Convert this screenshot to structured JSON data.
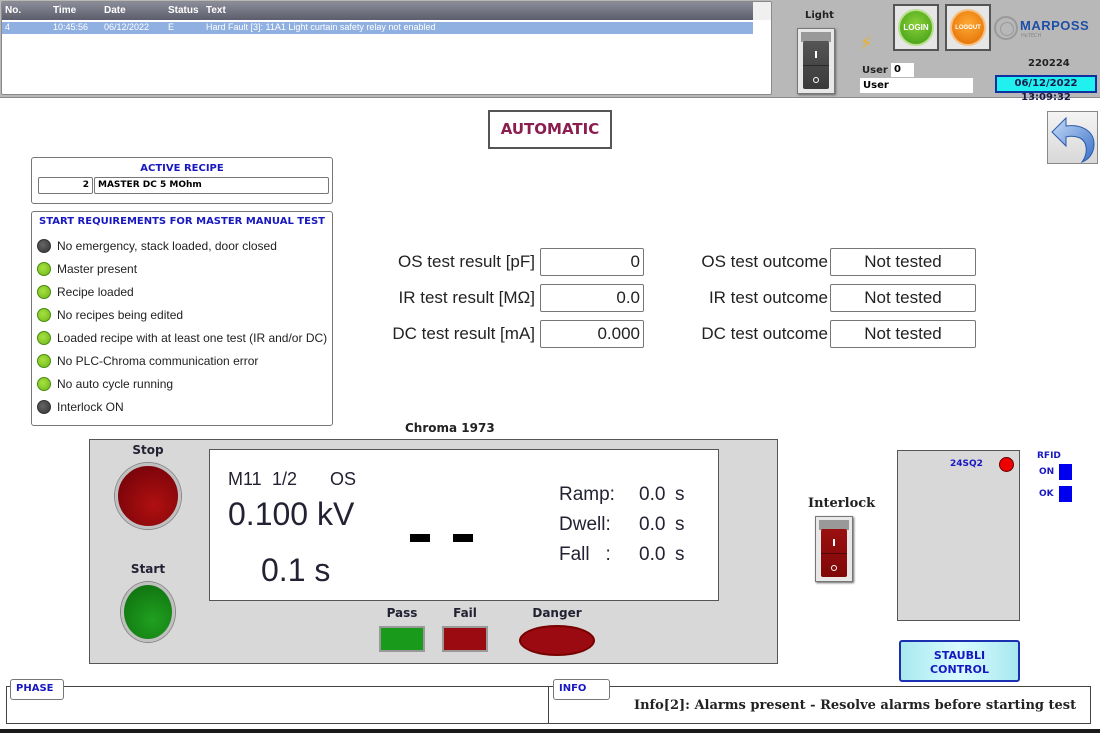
{
  "alarms": {
    "columns": {
      "no": "No.",
      "time": "Time",
      "date": "Date",
      "status": "Status",
      "text": "Text"
    },
    "rows": [
      {
        "no": "4",
        "time": "10:45:56",
        "date": "06/12/2022",
        "status": "E",
        "text": "Hard Fault [3]:  11A1 Light curtain safety relay not enabled"
      }
    ]
  },
  "header": {
    "light_label": "Light",
    "login_label": "LOGIN",
    "logout_label": "LOGOUT",
    "user_label": "User",
    "user_id": "0",
    "user_name": "User",
    "brand": "MARPOSS",
    "brand_sub": "HeTECH",
    "version": "220224",
    "datetime": "06/12/2022 13:09:32"
  },
  "mode": "AUTOMATIC",
  "recipe": {
    "title": "ACTIVE RECIPE",
    "number": "2",
    "name": "MASTER DC 5 MOhm"
  },
  "requirements": {
    "title": "START REQUIREMENTS FOR MASTER MANUAL TEST",
    "items": [
      {
        "label": "No emergency, stack loaded, door closed",
        "state": "off"
      },
      {
        "label": "Master present",
        "state": "on"
      },
      {
        "label": "Recipe loaded",
        "state": "on"
      },
      {
        "label": "No recipes being edited",
        "state": "on"
      },
      {
        "label": "Loaded recipe with at least one test (IR and/or DC)",
        "state": "on"
      },
      {
        "label": "No PLC-Chroma communication error",
        "state": "on"
      },
      {
        "label": "No auto cycle running",
        "state": "on"
      },
      {
        "label": "Interlock ON",
        "state": "off"
      }
    ]
  },
  "results": [
    {
      "label": "OS test result [pF]",
      "value": "0"
    },
    {
      "label": "IR test result [MΩ]",
      "value": "0.0"
    },
    {
      "label": "DC test result [mA]",
      "value": "0.000"
    }
  ],
  "outcomes": [
    {
      "label": "OS test outcome",
      "value": "Not tested"
    },
    {
      "label": "IR test outcome",
      "value": "Not tested"
    },
    {
      "label": "DC test outcome",
      "value": "Not tested"
    }
  ],
  "chroma": {
    "title": "Chroma 1973",
    "stop_label": "Stop",
    "start_label": "Start",
    "memory": "M11",
    "step": "1/2",
    "mode": "OS",
    "voltage": "0.100 kV",
    "time": "0.1 s",
    "ramp_label": "Ramp:",
    "ramp_value": "0.0",
    "dwell_label": "Dwell:",
    "dwell_value": "0.0",
    "fall_label": "Fall   :",
    "fall_value": "0.0",
    "unit": "s",
    "pass_label": "Pass",
    "fail_label": "Fail",
    "danger_label": "Danger"
  },
  "interlock_label": "Interlock",
  "staubli": {
    "sensor_label": "24SQ2",
    "rfid_title": "RFID",
    "rfid_on": "ON",
    "rfid_ok": "OK",
    "button_line1": "STAUBLI",
    "button_line2": "CONTROL"
  },
  "bottom": {
    "phase_label": "PHASE",
    "phase_text": "",
    "info_label": "INFO",
    "info_text": "Info[2]: Alarms present - Resolve alarms before starting  test"
  }
}
